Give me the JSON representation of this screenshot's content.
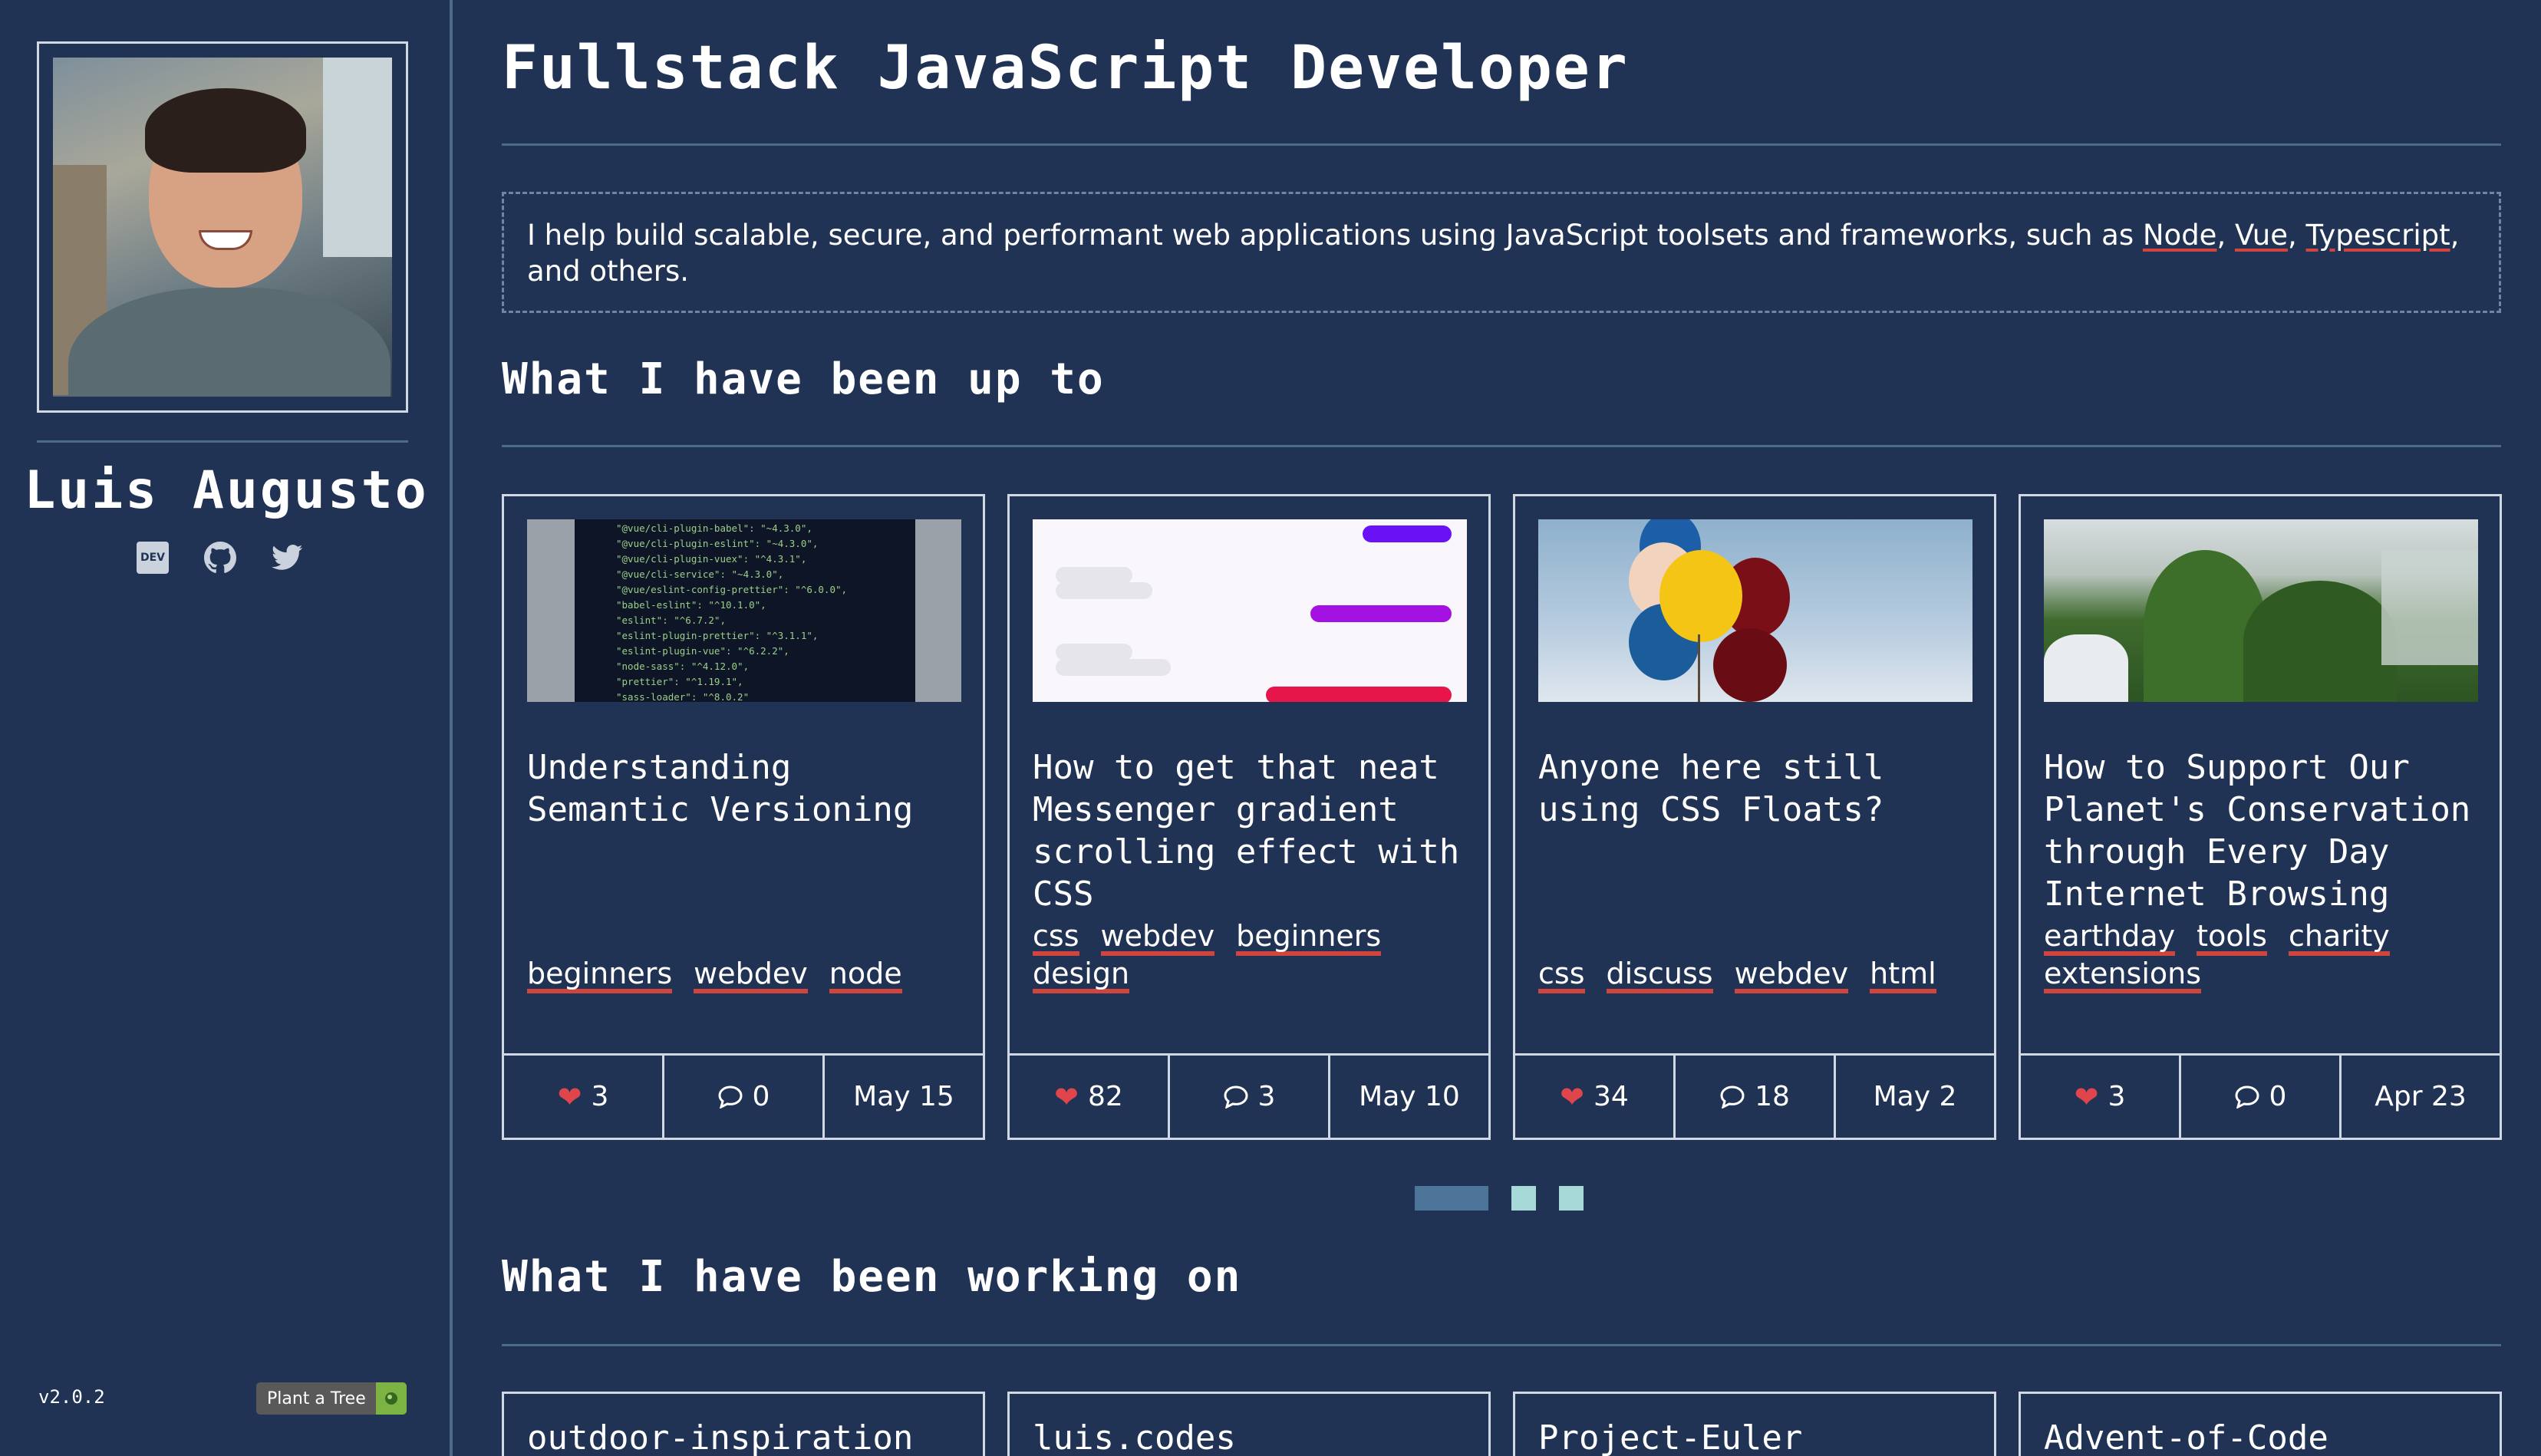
{
  "sidebar": {
    "name": "Luis Augusto",
    "social": [
      {
        "icon": "dev-icon",
        "label": "DEV"
      },
      {
        "icon": "github-icon"
      },
      {
        "icon": "twitter-icon"
      }
    ],
    "version": "v2.0.2",
    "plant_badge": "Plant a Tree"
  },
  "header": {
    "title": "Fullstack JavaScript Developer"
  },
  "intro": {
    "text_before": "I help build scalable, secure, and performant web applications using JavaScript toolsets and frameworks, such as ",
    "tech": [
      "Node",
      "Vue",
      "Typescript"
    ],
    "sep1": ", ",
    "sep2": ", ",
    "text_after": ", and others."
  },
  "sections": {
    "posts_heading": "What I have been up to",
    "projects_heading": "What I have been working on"
  },
  "posts": [
    {
      "title": "Understanding Semantic Versioning",
      "tags": [
        "beginners",
        "webdev",
        "node"
      ],
      "likes": "3",
      "comments": "0",
      "date": "May 15",
      "code_lines": "\"@vue/cli-plugin-babel\": \"~4.3.0\",\n\"@vue/cli-plugin-eslint\": \"~4.3.0\",\n\"@vue/cli-plugin-vuex\": \"^4.3.1\",\n\"@vue/cli-service\": \"~4.3.0\",\n\"@vue/eslint-config-prettier\": \"^6.0.0\",\n\"babel-eslint\": \"^10.1.0\",\n\"eslint\": \"^6.7.2\",\n\"eslint-plugin-prettier\": \"^3.1.1\",\n\"eslint-plugin-vue\": \"^6.2.2\",\n\"node-sass\": \"^4.12.0\",\n\"prettier\": \"^1.19.1\",\n\"sass-loader\": \"^8.0.2\""
    },
    {
      "title": "How to get that neat Messenger gradient scrolling effect with CSS",
      "tags": [
        "css",
        "webdev",
        "beginners",
        "design"
      ],
      "likes": "82",
      "comments": "3",
      "date": "May 10"
    },
    {
      "title": "Anyone here still using CSS Floats?",
      "tags": [
        "css",
        "discuss",
        "webdev",
        "html"
      ],
      "likes": "34",
      "comments": "18",
      "date": "May 2"
    },
    {
      "title": "How to Support Our Planet's Conservation through Every Day Internet Browsing",
      "tags": [
        "earthday",
        "tools",
        "charity",
        "extensions"
      ],
      "likes": "3",
      "comments": "0",
      "date": "Apr 23"
    }
  ],
  "carousel": {
    "pages": 3,
    "active": 1
  },
  "projects": [
    {
      "name": "outdoor-inspiration"
    },
    {
      "name": "luis.codes"
    },
    {
      "name": "Project-Euler"
    },
    {
      "name": "Advent-of-Code"
    }
  ],
  "colors": {
    "background": "#213354",
    "accent_red": "#d0463f",
    "border": "#cfd8e3",
    "divider": "#4b6a8c"
  }
}
